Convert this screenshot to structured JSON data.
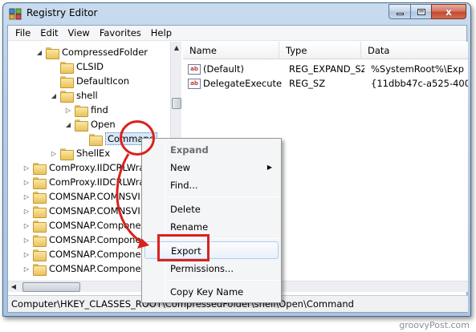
{
  "window": {
    "title": "Registry Editor",
    "caption_close": "x"
  },
  "menubar": [
    "File",
    "Edit",
    "View",
    "Favorites",
    "Help"
  ],
  "tree": {
    "items": [
      {
        "label": "CompressedFolder",
        "expander": "expanded"
      },
      {
        "label": "CLSID",
        "expander": "none"
      },
      {
        "label": "DefaultIcon",
        "expander": "none"
      },
      {
        "label": "shell",
        "expander": "expanded"
      },
      {
        "label": "find",
        "expander": "collapsed"
      },
      {
        "label": "Open",
        "expander": "expanded"
      },
      {
        "label": "Command",
        "expander": "none",
        "selected": true
      },
      {
        "label": "ShellEx",
        "expander": "collapsed"
      },
      {
        "label": "ComProxy.IIDCRLWra",
        "expander": "collapsed"
      },
      {
        "label": "ComProxy.IIDCRLWra",
        "expander": "collapsed"
      },
      {
        "label": "COMSNAP.COMNSVI",
        "expander": "collapsed"
      },
      {
        "label": "COMSNAP.COMNSVI",
        "expander": "collapsed"
      },
      {
        "label": "COMSNAP.Compone",
        "expander": "collapsed"
      },
      {
        "label": "COMSNAP.Compone",
        "expander": "collapsed"
      },
      {
        "label": "COMSNAP.Compone",
        "expander": "collapsed"
      },
      {
        "label": "COMSNAP.Compone",
        "expander": "collapsed"
      }
    ]
  },
  "list": {
    "columns": [
      "Name",
      "Type",
      "Data"
    ],
    "rows": [
      {
        "name": "(Default)",
        "type": "REG_EXPAND_SZ",
        "data": "%SystemRoot%\\Exp",
        "icon": "string-value-icon"
      },
      {
        "name": "DelegateExecute",
        "type": "REG_SZ",
        "data": "{11dbb47c-a525-400",
        "icon": "string-value-icon"
      }
    ]
  },
  "context_menu": {
    "items": [
      {
        "label": "Expand",
        "disabled": true
      },
      {
        "label": "New",
        "submenu": true
      },
      {
        "label": "Find..."
      },
      {
        "label": "Delete"
      },
      {
        "label": "Rename"
      },
      {
        "label": "Export",
        "highlighted": true
      },
      {
        "label": "Permissions..."
      },
      {
        "label": "Copy Key Name"
      }
    ]
  },
  "statusbar": {
    "path": "Computer\\HKEY_CLASSES_ROOT\\CompressedFolder\\shell\\Open\\Command"
  },
  "annotation_color": "#d9221c",
  "watermark": "groovyPost.com"
}
